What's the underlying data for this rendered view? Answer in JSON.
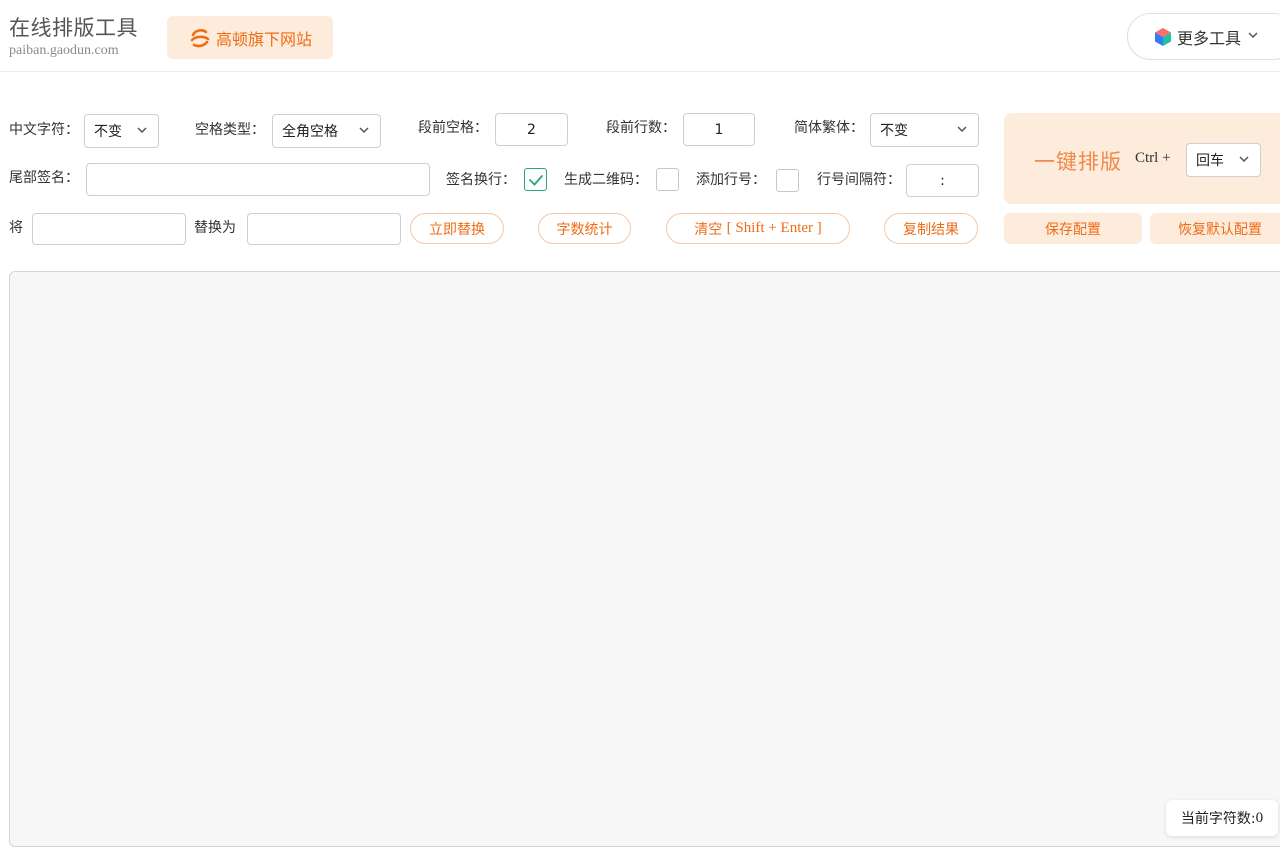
{
  "header": {
    "site_title": "在线排版工具",
    "site_domain": "paiban.gaodun.com",
    "brand_badge": "高顿旗下网站",
    "more_tools": "更多工具"
  },
  "row1": {
    "chinese_chars_label": "中文字符：",
    "chinese_chars_value": "不变",
    "space_type_label": "空格类型：",
    "space_type_value": "全角空格",
    "para_spaces_label": "段前空格：",
    "para_spaces_value": "2",
    "para_lines_label": "段前行数：",
    "para_lines_value": "1",
    "simp_trad_label": "简体繁体：",
    "simp_trad_value": "不变"
  },
  "row2": {
    "signature_label": "尾部签名：",
    "signature_value": "",
    "sig_newline_label": "签名换行：",
    "sig_newline_checked": true,
    "qrcode_label": "生成二维码：",
    "qrcode_checked": false,
    "line_numbers_label": "添加行号：",
    "line_numbers_checked": false,
    "line_sep_label": "行号间隔符：",
    "line_sep_value": ":"
  },
  "row3": {
    "replace_from_label": "将",
    "replace_from_value": "",
    "replace_to_label": "替换为",
    "replace_to_value": "",
    "replace_now_button": "立即替换",
    "word_count_button": "字数统计",
    "clear_button_prefix": "清空 ",
    "clear_button_shortcut": "[ Shift + Enter ]",
    "copy_result_button": "复制结果"
  },
  "onekey": {
    "button": "一键排版",
    "ctrl_label": "Ctrl +",
    "key_value": "回车"
  },
  "config": {
    "save_button": "保存配置",
    "restore_button": "恢复默认配置"
  },
  "editor": {
    "content": "",
    "char_count_label": "当前字符数:",
    "char_count_value": "0"
  },
  "colors": {
    "accent": "#ef6c16",
    "accent_light": "#fdebdc",
    "check_green": "#2aa87c"
  }
}
